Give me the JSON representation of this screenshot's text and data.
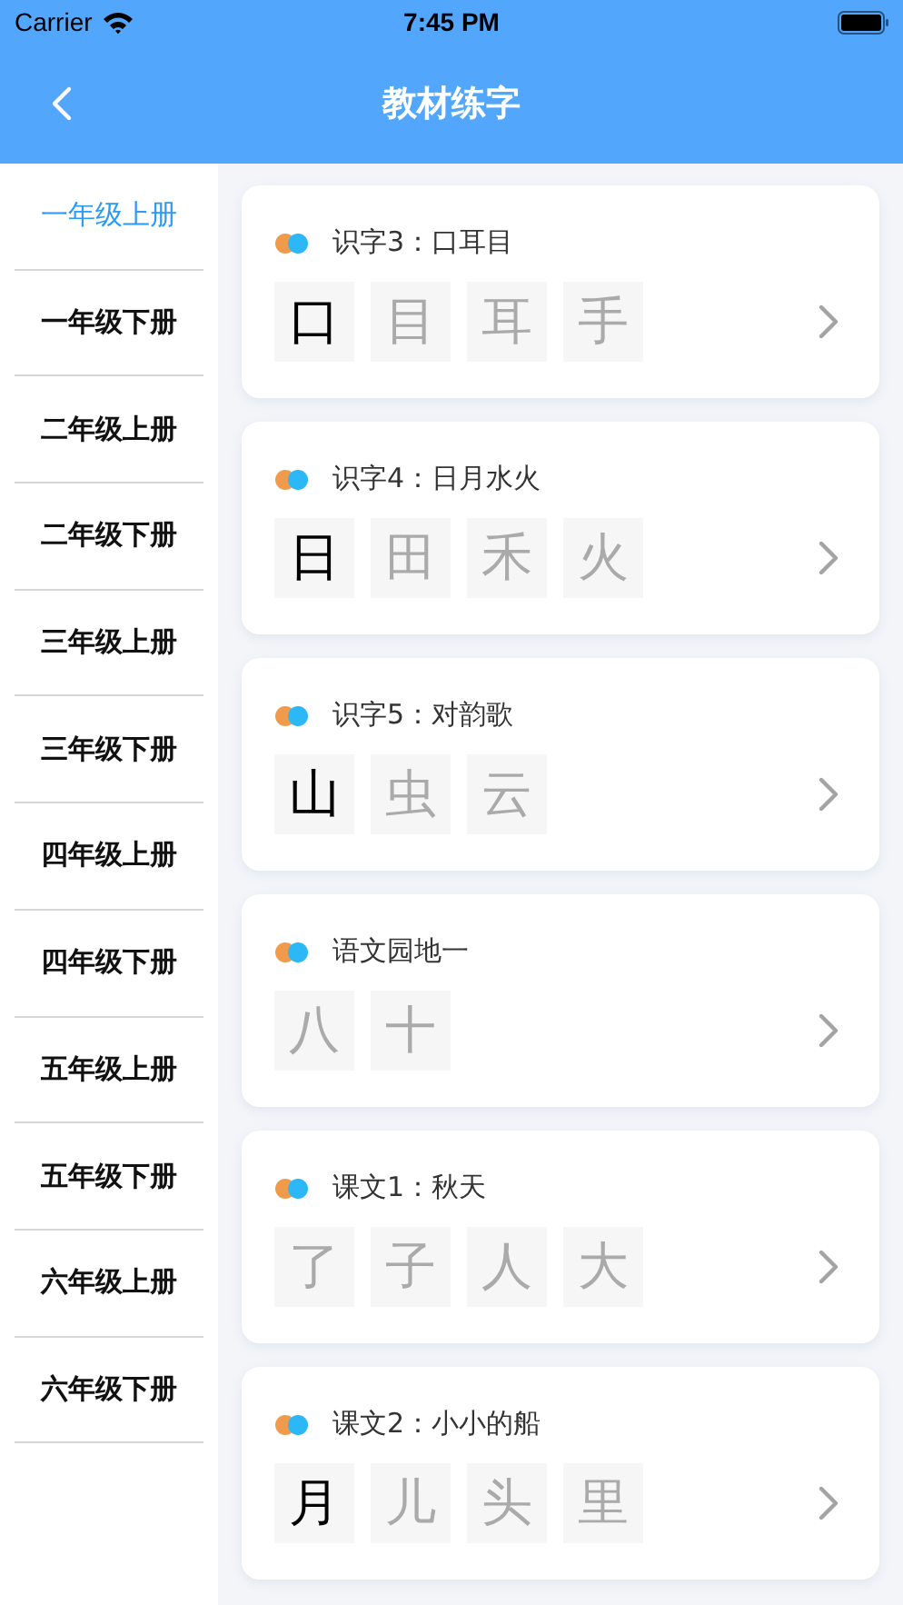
{
  "status_bar": {
    "carrier": "Carrier",
    "time": "7:45 PM"
  },
  "nav": {
    "title": "教材练字"
  },
  "sidebar": {
    "items": [
      {
        "label": "一年级上册",
        "selected": true
      },
      {
        "label": "一年级下册",
        "selected": false
      },
      {
        "label": "二年级上册",
        "selected": false
      },
      {
        "label": "二年级下册",
        "selected": false
      },
      {
        "label": "三年级上册",
        "selected": false
      },
      {
        "label": "三年级下册",
        "selected": false
      },
      {
        "label": "四年级上册",
        "selected": false
      },
      {
        "label": "四年级下册",
        "selected": false
      },
      {
        "label": "五年级上册",
        "selected": false
      },
      {
        "label": "五年级下册",
        "selected": false
      },
      {
        "label": "六年级上册",
        "selected": false
      },
      {
        "label": "六年级下册",
        "selected": false
      }
    ]
  },
  "lessons": [
    {
      "title": "识字3：口耳目",
      "chars": [
        {
          "char": "口",
          "done": true
        },
        {
          "char": "目",
          "done": false
        },
        {
          "char": "耳",
          "done": false
        },
        {
          "char": "手",
          "done": false
        }
      ]
    },
    {
      "title": "识字4：日月水火",
      "chars": [
        {
          "char": "日",
          "done": true
        },
        {
          "char": "田",
          "done": false
        },
        {
          "char": "禾",
          "done": false
        },
        {
          "char": "火",
          "done": false
        }
      ]
    },
    {
      "title": "识字5：对韵歌",
      "chars": [
        {
          "char": "山",
          "done": true
        },
        {
          "char": "虫",
          "done": false
        },
        {
          "char": "云",
          "done": false
        }
      ]
    },
    {
      "title": "语文园地一",
      "chars": [
        {
          "char": "八",
          "done": false
        },
        {
          "char": "十",
          "done": false
        }
      ]
    },
    {
      "title": "课文1：秋天",
      "chars": [
        {
          "char": "了",
          "done": false
        },
        {
          "char": "子",
          "done": false
        },
        {
          "char": "人",
          "done": false
        },
        {
          "char": "大",
          "done": false
        }
      ]
    },
    {
      "title": "课文2：小小的船",
      "chars": [
        {
          "char": "月",
          "done": true
        },
        {
          "char": "儿",
          "done": false
        },
        {
          "char": "头",
          "done": false
        },
        {
          "char": "里",
          "done": false
        }
      ]
    }
  ]
}
